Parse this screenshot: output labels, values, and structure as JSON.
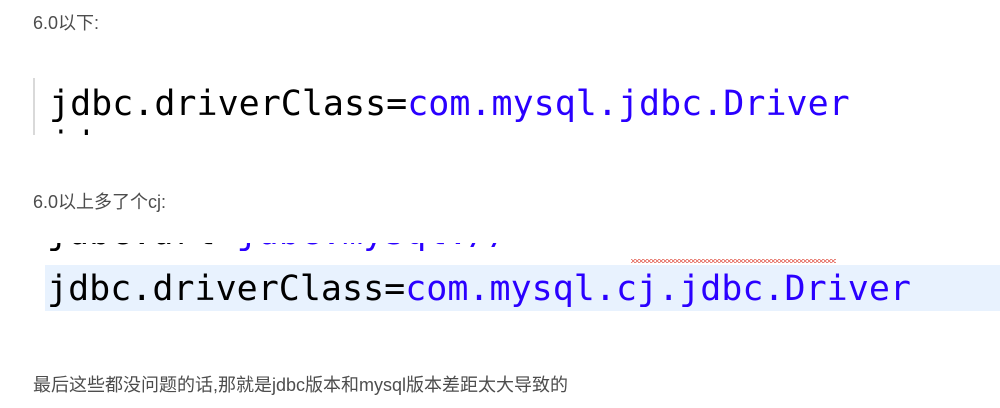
{
  "paragraphs": {
    "below_6": "6.0以下:",
    "above_6": "6.0以上多了个cj:",
    "conclusion": "最后这些都没问题的话,那就是jdbc版本和mysql版本差距太大导致的"
  },
  "code_old": {
    "key": "jdbc.driverClass=",
    "value": "com.mysql.jdbc.Driver"
  },
  "code_new": {
    "key": "jdbc.driverClass=",
    "value": "com.mysql.cj.jdbc.Driver"
  },
  "colors": {
    "text": "#4d4d4d",
    "code_key": "#000000",
    "code_value": "#2a00ff",
    "line_highlight": "#e8f2fe",
    "spell_squiggle": "#e0574a"
  }
}
